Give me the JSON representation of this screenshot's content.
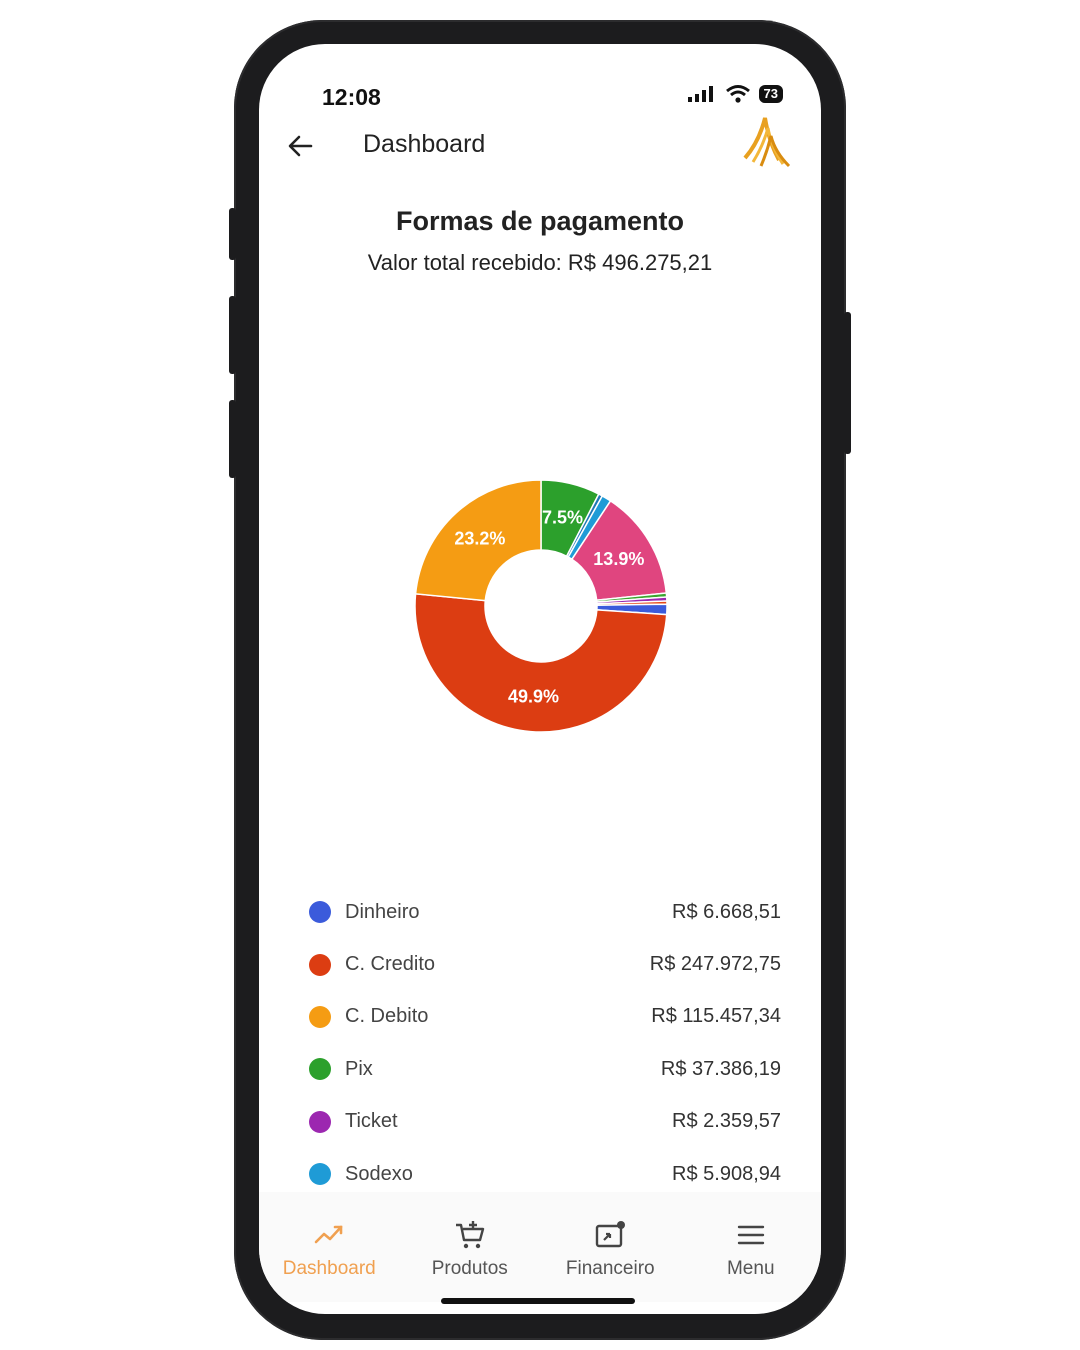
{
  "status": {
    "time": "12:08",
    "battery": "73"
  },
  "header": {
    "title": "Dashboard"
  },
  "chart_header": {
    "title": "Formas de pagamento",
    "subtitle": "Valor total recebido: R$ 496.275,21"
  },
  "chart_data": {
    "type": "pie",
    "title": "Formas de pagamento",
    "slices": [
      {
        "name": "Pix",
        "percent": 7.5,
        "color": "#2ca02c",
        "label": "7.5%"
      },
      {
        "name": "",
        "percent": 0.5,
        "color": "#1f77b4",
        "label": ""
      },
      {
        "name": "Sodexo",
        "percent": 1.2,
        "color": "#1f9bd6",
        "label": ""
      },
      {
        "name": "",
        "percent": 13.9,
        "color": "#e0457f",
        "label": "13.9%"
      },
      {
        "name": "",
        "percent": 0.5,
        "color": "#3aa62e",
        "label": ""
      },
      {
        "name": "Ticket",
        "percent": 0.5,
        "color": "#9c27b0",
        "label": ""
      },
      {
        "name": "",
        "percent": 0.4,
        "color": "#e64a19",
        "label": ""
      },
      {
        "name": "Dinheiro",
        "percent": 1.3,
        "color": "#3b5bdb",
        "label": ""
      },
      {
        "name": "C. Credito",
        "percent": 49.9,
        "color": "#dc3d12",
        "label": "49.9%"
      },
      {
        "name": "C. Debito",
        "percent": 23.2,
        "color": "#f59c13",
        "label": "23.2%"
      }
    ]
  },
  "legend": [
    {
      "label": "Dinheiro",
      "value": "R$ 6.668,51",
      "color": "#3b5bdb"
    },
    {
      "label": "C. Credito",
      "value": "R$ 247.972,75",
      "color": "#dc3d12"
    },
    {
      "label": "C. Debito",
      "value": "R$ 115.457,34",
      "color": "#f59c13"
    },
    {
      "label": "Pix",
      "value": "R$ 37.386,19",
      "color": "#2ca02c"
    },
    {
      "label": "Ticket",
      "value": "R$ 2.359,57",
      "color": "#9c27b0"
    },
    {
      "label": "Sodexo",
      "value": "R$ 5.908,94",
      "color": "#1f9bd6"
    }
  ],
  "nav": {
    "items": [
      {
        "label": "Dashboard",
        "icon": "chart-trend-icon"
      },
      {
        "label": "Produtos",
        "icon": "cart-add-icon"
      },
      {
        "label": "Financeiro",
        "icon": "finance-icon"
      },
      {
        "label": "Menu",
        "icon": "menu-icon"
      }
    ],
    "active_color": "#f0a050"
  }
}
